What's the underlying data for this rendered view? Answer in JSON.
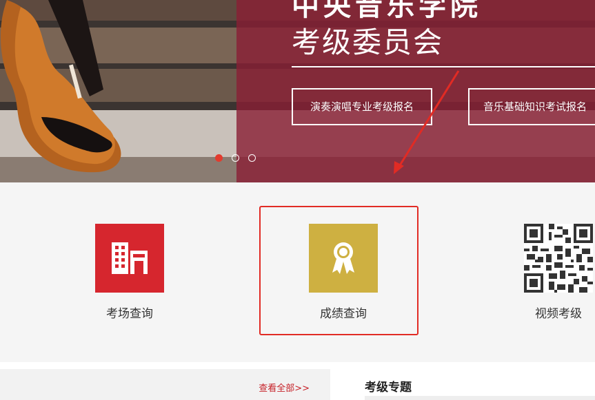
{
  "banner": {
    "title": "中央音乐学院",
    "subtitle": "考级委员会",
    "buttons": [
      {
        "label": "演奏演唱专业考级报名"
      },
      {
        "label": "音乐基础知识考试报名"
      }
    ],
    "slide_count": 3,
    "active_slide": 1
  },
  "services": [
    {
      "label": "考场查询",
      "icon": "building-icon",
      "color": "#d6262e"
    },
    {
      "label": "成绩查询",
      "icon": "award-ribbon-icon",
      "color": "#ceb041"
    },
    {
      "label": "视频考级",
      "icon": "qr-code-icon"
    }
  ],
  "news": {
    "more_link": "查看全部>>"
  },
  "topics": {
    "title": "考级专题"
  },
  "colors": {
    "accent": "#c62128",
    "overlay": "#8a1e34",
    "highlight": "#e12b24"
  }
}
